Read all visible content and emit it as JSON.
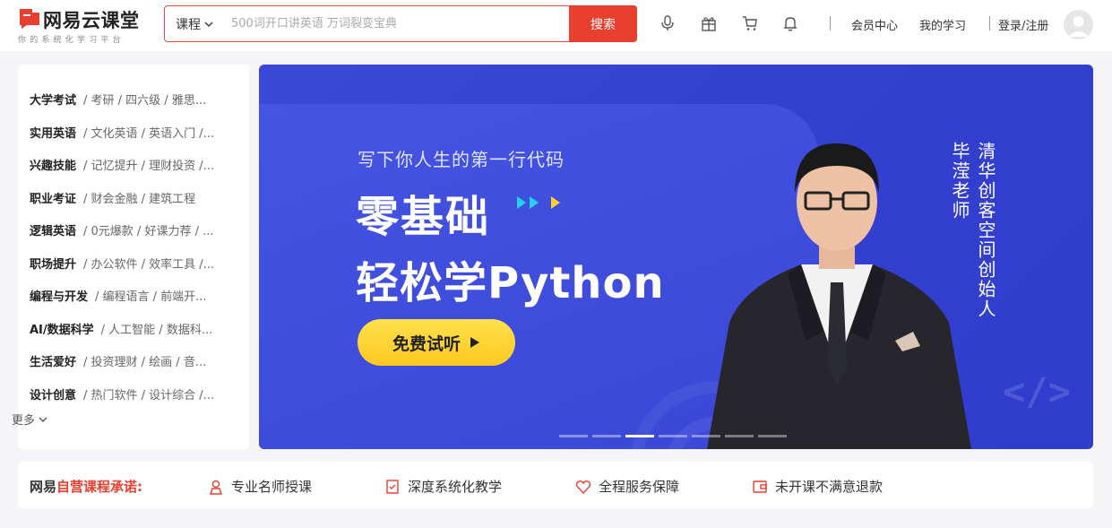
{
  "header": {
    "logo_title": "网易云课堂",
    "logo_subtitle": "你的系统化学习平台",
    "search": {
      "category": "课程",
      "placeholder": "500词开口讲英语 万词裂变宝典",
      "button": "搜索"
    },
    "icons": [
      "microphone-icon",
      "gift-icon",
      "cart-icon",
      "bell-icon"
    ],
    "links": {
      "vip": "会员中心",
      "my_learning": "我的学习",
      "login": "登录/注册"
    }
  },
  "sidebar": {
    "categories": [
      {
        "name": "大学考试",
        "subs": "/ 考研 / 四六级 / 雅思..."
      },
      {
        "name": "实用英语",
        "subs": "/ 文化英语 / 英语入门 /..."
      },
      {
        "name": "兴趣技能",
        "subs": "/ 记忆提升 / 理财投资 /..."
      },
      {
        "name": "职业考证",
        "subs": "/ 财会金融 / 建筑工程"
      },
      {
        "name": "逻辑英语",
        "subs": "/ 0元爆款 / 好课力荐 / ..."
      },
      {
        "name": "职场提升",
        "subs": "/ 办公软件 / 效率工具 /..."
      },
      {
        "name": "编程与开发",
        "subs": "/ 编程语言 / 前端开..."
      },
      {
        "name": "AI/数据科学",
        "subs": "/ 人工智能 / 数据科..."
      },
      {
        "name": "生活爱好",
        "subs": "/ 投资理财 / 绘画 / 音..."
      },
      {
        "name": "设计创意",
        "subs": "/ 热门软件 / 设计综合 /..."
      }
    ],
    "more": "更多"
  },
  "banner": {
    "tagline": "写下你人生的第一行代码",
    "title_line1": "零基础",
    "title_line2": "轻松学Python",
    "cta": "免费试听",
    "teacher_name": "毕滢老师",
    "teacher_title": "清华创客空间创始人",
    "deco": "</>",
    "carousel_active_index": 2,
    "carousel_count": 7,
    "colors": {
      "bg": "#3c49d8",
      "cta": "#ffd02e",
      "arrow_cyan": "#22d3ee",
      "arrow_yellow": "#ffd02e"
    }
  },
  "promise": {
    "title_prefix": "网易",
    "title_highlight": "自营课程承诺:",
    "items": [
      {
        "icon": "teacher-icon",
        "label": "专业名师授课"
      },
      {
        "icon": "book-check-icon",
        "label": "深度系统化教学"
      },
      {
        "icon": "heart-icon",
        "label": "全程服务保障"
      },
      {
        "icon": "wallet-icon",
        "label": "未开课不满意退款"
      }
    ]
  },
  "colors": {
    "brand_red": "#e83f2e",
    "page_bg": "#f5f5f7"
  }
}
